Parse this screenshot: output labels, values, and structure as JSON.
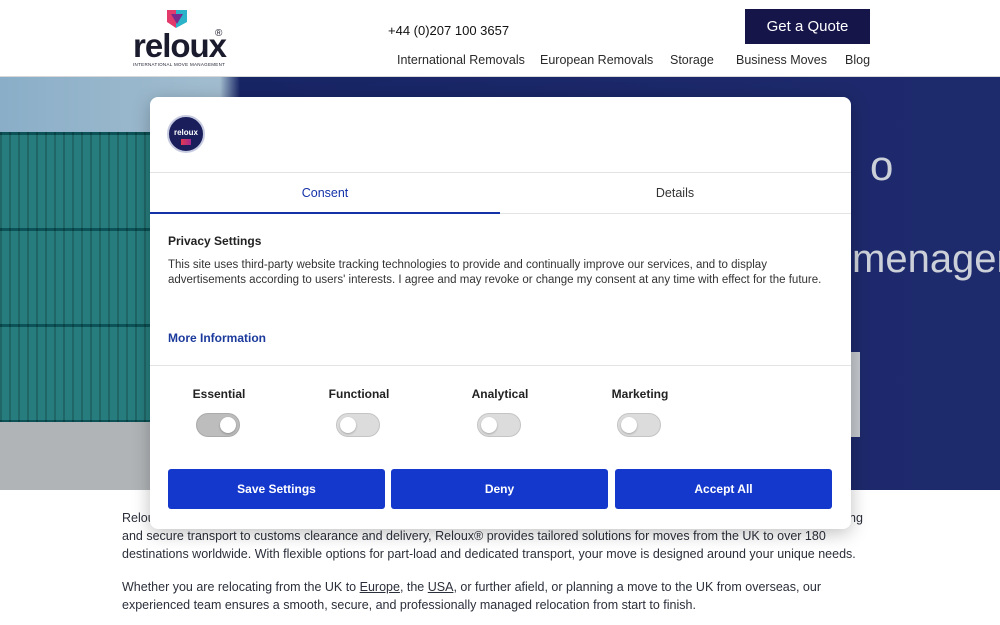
{
  "header": {
    "logo_text": "reloux",
    "logo_registered": "®",
    "logo_tagline": "INTERNATIONAL MOVE MANAGEMENT",
    "phone": "+44 (0)207 100 3657",
    "quote_button": "Get a Quote",
    "nav": [
      "International Removals",
      "European Removals",
      "Storage",
      "Business Moves",
      "Blog"
    ],
    "brand_color": "#16154a"
  },
  "hero": {
    "truck_text_1": "o",
    "truck_text_2": "menager"
  },
  "body": {
    "paragraph1_line1_start": "Relou",
    "paragraph1_line1_end": "ng",
    "paragraph1_line2": "and secure transport to customs clearance and delivery, Reloux® provides tailored solutions for moves from the UK to over 180",
    "paragraph1_line3": "destinations worldwide. With flexible options for part-load and dedicated transport, your move is designed around your unique needs.",
    "paragraph2_part1": "Whether you are relocating from the UK to ",
    "link_europe": "Europe",
    "paragraph2_part2": ", the ",
    "link_usa": "USA",
    "paragraph2_part3": ", or further afield, or planning a move to the UK from overseas, our",
    "paragraph2_line2": "experienced team ensures a smooth, secure, and professionally managed relocation from start to finish."
  },
  "consent": {
    "logo_text": "reloux",
    "tabs": [
      {
        "label": "Consent",
        "active": true
      },
      {
        "label": "Details",
        "active": false
      }
    ],
    "title": "Privacy Settings",
    "text": "This site uses third-party website tracking technologies to provide and continually improve our services, and to display advertisements according to users' interests. I agree and may revoke or change my consent at any time with effect for the future.",
    "more_info": "More Information",
    "categories": [
      {
        "label": "Essential",
        "state": "on-disabled"
      },
      {
        "label": "Functional",
        "state": "off"
      },
      {
        "label": "Analytical",
        "state": "off"
      },
      {
        "label": "Marketing",
        "state": "off"
      }
    ],
    "buttons": {
      "save": "Save Settings",
      "deny": "Deny",
      "accept": "Accept All"
    },
    "accent_color": "#1538cc"
  }
}
